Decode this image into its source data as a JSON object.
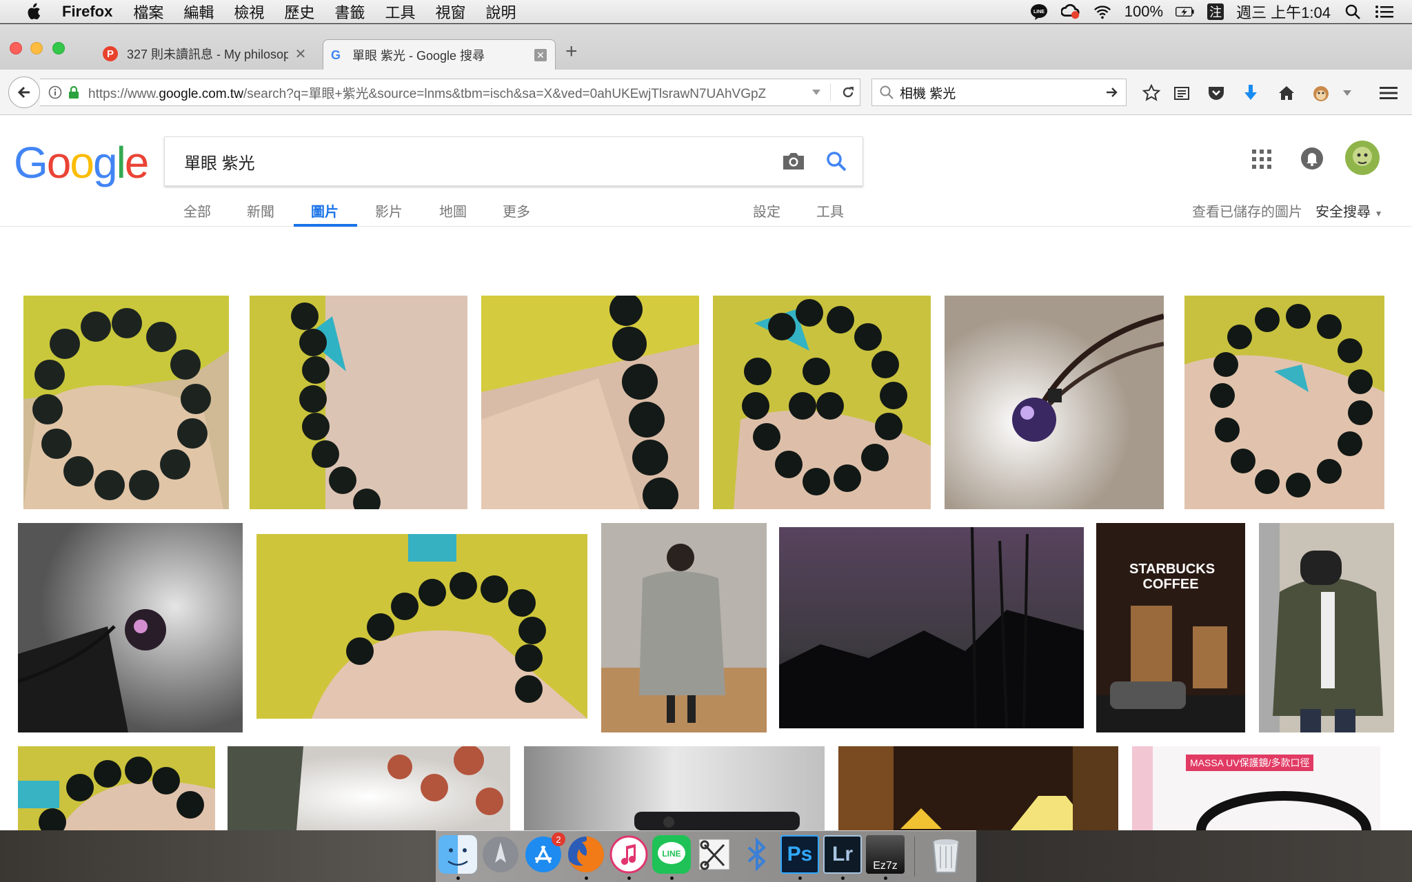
{
  "menubar": {
    "app_name": "Firefox",
    "items": [
      "檔案",
      "編輯",
      "檢視",
      "歷史",
      "書籤",
      "工具",
      "視窗",
      "說明"
    ],
    "battery": "100%",
    "input_method": "注",
    "clock": "週三 上午1:04"
  },
  "browser": {
    "tabs": [
      {
        "title": "327 則未讀訊息 - My philosoph",
        "active": false
      },
      {
        "title": "單眼 紫光 - Google 搜尋",
        "active": true
      }
    ],
    "url_prefix": "https://www.",
    "url_host": "google.com.tw",
    "url_rest": "/search?q=單眼+紫光&source=lnms&tbm=isch&sa=X&ved=0ahUKEwjTlsrawN7UAhVGpZ",
    "search_box": "相機 紫光"
  },
  "google": {
    "query": "單眼 紫光",
    "tabs": [
      "全部",
      "新聞",
      "圖片",
      "影片",
      "地圖",
      "更多"
    ],
    "active_tab": "圖片",
    "settings": "設定",
    "tools": "工具",
    "saved_images": "查看已儲存的圖片",
    "safe_search": "安全搜尋",
    "thumb_texts": {
      "starbucks": "STARBUCKS COFFEE",
      "massa": "MASSA UV保護鏡/多款口徑"
    }
  },
  "dock": {
    "apps": [
      "Finder",
      "Launchpad",
      "App Store",
      "Firefox",
      "iTunes",
      "LINE",
      "Scissors",
      "Bluetooth",
      "Photoshop",
      "Lightroom",
      "Ez7z",
      "Trash"
    ],
    "appstore_badge": "2",
    "ps_label": "Ps",
    "lr_label": "Lr",
    "ez_label": "Ez7z"
  },
  "colors": {
    "google_blue": "#4285F4",
    "google_red": "#EA4335",
    "google_yellow": "#FBBC05",
    "google_green": "#34A853",
    "active_tab": "#1a73e8"
  }
}
